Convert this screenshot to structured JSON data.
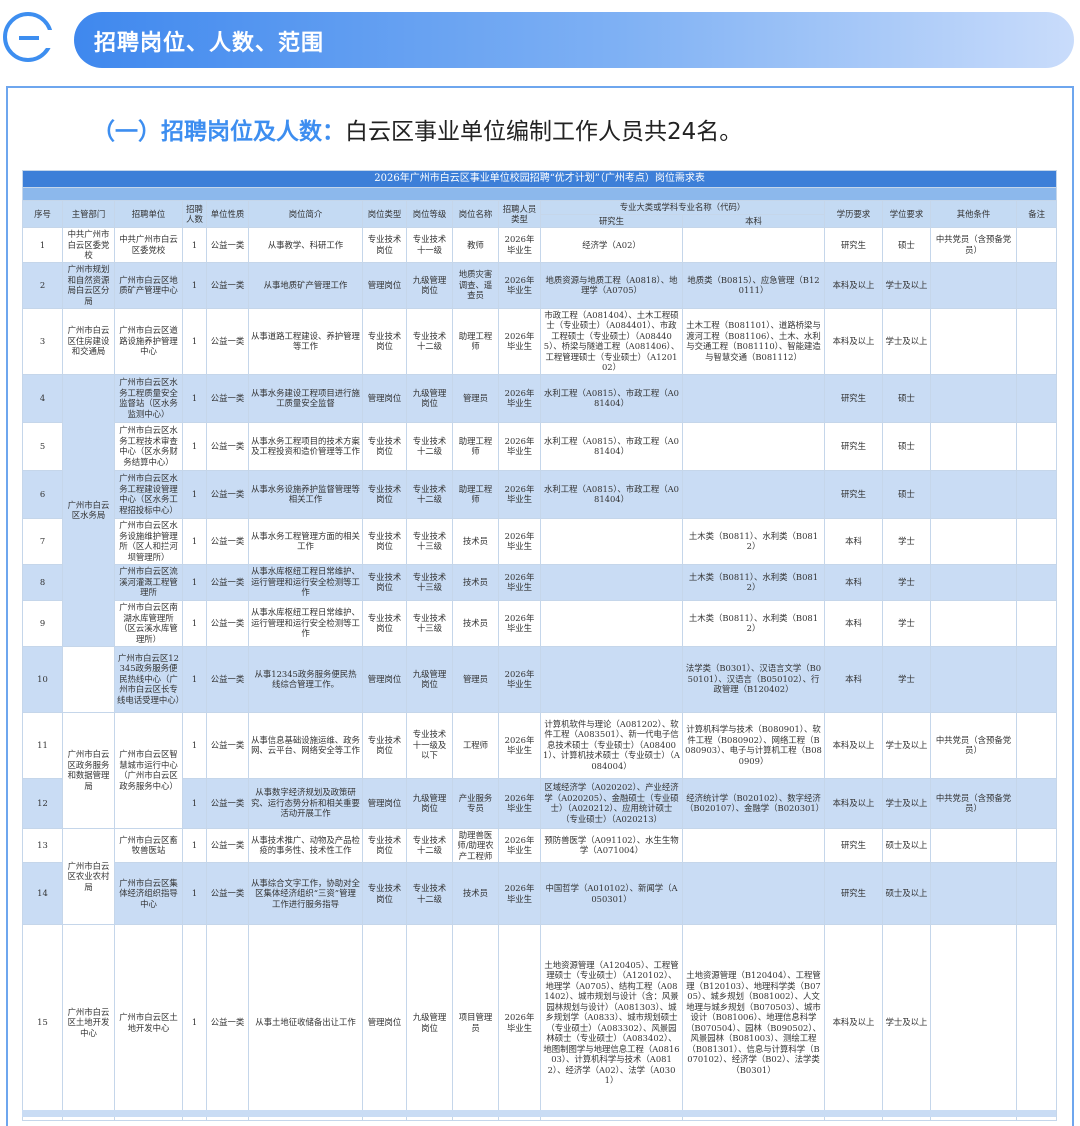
{
  "header": {
    "title": "招聘岗位、人数、范围"
  },
  "section": {
    "highlight": "（一）招聘岗位及人数：",
    "text": "白云区事业单位编制工作人员共24名。"
  },
  "table": {
    "title": "2026年广州市白云区事业单位校园招聘“优才计划”（广州考点）岗位需求表",
    "headers": {
      "seq": "序号",
      "dept": "主管部门",
      "unit": "招聘单位",
      "count": "招聘人数",
      "nature": "单位性质",
      "intro": "岗位简介",
      "type": "岗位类型",
      "level": "岗位等级",
      "name": "岗位名称",
      "target": "招聘人员类型",
      "major": "专业大类或学科专业名称（代码）",
      "grad": "研究生",
      "under": "本科",
      "edu": "学历要求",
      "degree": "学位要求",
      "other": "其他条件",
      "note": "备注"
    },
    "rows": [
      {
        "seq": "1",
        "dept": "中共广州市白云区委党校",
        "unit": "中共广州市白云区委党校",
        "count": "1",
        "nature": "公益一类",
        "intro": "从事教学、科研工作",
        "type": "专业技术岗位",
        "level": "专业技术十一级",
        "name": "教师",
        "target": "2026年毕业生",
        "grad": "经济学（A02）",
        "under": "",
        "edu": "研究生",
        "degree": "硕士",
        "other": "中共党员（含预备党员）"
      },
      {
        "seq": "2",
        "dept": "广州市规划和自然资源局白云区分局",
        "unit": "广州市白云区地质矿产管理中心",
        "count": "1",
        "nature": "公益一类",
        "intro": "从事地质矿产管理工作",
        "type": "管理岗位",
        "level": "九级管理岗位",
        "name": "地质灾害调查、遥查员",
        "target": "2026年毕业生",
        "grad": "地质资源与地质工程（A0818）、地理学（A0705）",
        "under": "地质类（B0815）、应急管理（B120111）",
        "edu": "本科及以上",
        "degree": "学士及以上",
        "other": ""
      },
      {
        "seq": "3",
        "dept": "广州市白云区住房建设和交通局",
        "unit": "广州市白云区道路设施养护管理中心",
        "count": "1",
        "nature": "公益一类",
        "intro": "从事道路工程建设、养护管理等工作",
        "type": "专业技术岗位",
        "level": "专业技术十二级",
        "name": "助理工程师",
        "target": "2026年毕业生",
        "grad": "市政工程（A081404）、土木工程硕士（专业硕士）（A084401）、市政工程硕士（专业硕士）（A084405）、桥梁与隧道工程（A081406）、工程管理硕士（专业硕士）（A120102）",
        "under": "土木工程（B081101）、道路桥梁与渡河工程（B081106）、土木、水利与交通工程（B081110）、智能建造与智慧交通（B081112）",
        "edu": "本科及以上",
        "degree": "学士及以上",
        "other": ""
      },
      {
        "seq": "4",
        "dept": "",
        "unit": "广州市白云区水务工程质量安全监督站（区水务监测中心）",
        "count": "1",
        "nature": "公益一类",
        "intro": "从事水务建设工程项目进行施工质量安全监督",
        "type": "管理岗位",
        "level": "九级管理岗位",
        "name": "管理员",
        "target": "2026年毕业生",
        "grad": "水利工程（A0815）、市政工程（A081404）",
        "under": "",
        "edu": "研究生",
        "degree": "硕士",
        "other": ""
      },
      {
        "seq": "5",
        "dept": "",
        "unit": "广州市白云区水务工程技术审查中心（区水务财务结算中心）",
        "count": "1",
        "nature": "公益一类",
        "intro": "从事水务工程项目的技术方案及工程投资和造价管理等工作",
        "type": "专业技术岗位",
        "level": "专业技术十二级",
        "name": "助理工程师",
        "target": "2026年毕业生",
        "grad": "水利工程（A0815）、市政工程（A081404）",
        "under": "",
        "edu": "研究生",
        "degree": "硕士",
        "other": ""
      },
      {
        "seq": "6",
        "dept": "广州市白云区水务局",
        "unit": "广州市白云区水务工程建设管理中心（区水务工程招投标中心）",
        "count": "1",
        "nature": "公益一类",
        "intro": "从事水务设施养护监督管理等相关工作",
        "type": "专业技术岗位",
        "level": "专业技术十二级",
        "name": "助理工程师",
        "target": "2026年毕业生",
        "grad": "水利工程（A0815）、市政工程（A081404）",
        "under": "",
        "edu": "研究生",
        "degree": "硕士",
        "other": ""
      },
      {
        "seq": "7",
        "dept": "",
        "unit": "广州市白云区水务设施维护管理所（区人和拦河坝管理所）",
        "count": "1",
        "nature": "公益一类",
        "intro": "从事水务工程管理方面的相关工作",
        "type": "专业技术岗位",
        "level": "专业技术十三级",
        "name": "技术员",
        "target": "2026年毕业生",
        "grad": "",
        "under": "土木类（B0811）、水利类（B0812）",
        "edu": "本科",
        "degree": "学士",
        "other": ""
      },
      {
        "seq": "8",
        "dept": "",
        "unit": "广州市白云区流溪河灌溉工程管理所",
        "count": "1",
        "nature": "公益一类",
        "intro": "从事水库枢纽工程日常维护、运行管理和运行安全检测等工作",
        "type": "专业技术岗位",
        "level": "专业技术十三级",
        "name": "技术员",
        "target": "2026年毕业生",
        "grad": "",
        "under": "土木类（B0811）、水利类（B0812）",
        "edu": "本科",
        "degree": "学士",
        "other": ""
      },
      {
        "seq": "9",
        "dept": "",
        "unit": "广州市白云区南湖水库管理所（区云溪水库管理所）",
        "count": "1",
        "nature": "公益一类",
        "intro": "从事水库枢纽工程日常维护、运行管理和运行安全检测等工作",
        "type": "专业技术岗位",
        "level": "专业技术十三级",
        "name": "技术员",
        "target": "2026年毕业生",
        "grad": "",
        "under": "土木类（B0811）、水利类（B0812）",
        "edu": "本科",
        "degree": "学士",
        "other": ""
      },
      {
        "seq": "10",
        "dept": "",
        "unit": "广州市白云区12345政务服务便民热线中心（广州市白云区长专线电话受理中心）",
        "count": "1",
        "nature": "公益一类",
        "intro": "从事12345政务服务便民热线综合管理工作。",
        "type": "管理岗位",
        "level": "九级管理岗位",
        "name": "管理员",
        "target": "2026年毕业生",
        "grad": "",
        "under": "法学类（B0301）、汉语言文学（B050101）、汉语言（B050102）、行政管理（B120402）",
        "edu": "本科",
        "degree": "学士",
        "other": ""
      },
      {
        "seq": "11",
        "dept": "广州市白云区政务服务和数据管理局",
        "unit": "广州市白云区智慧城市运行中心（广州市白云区政务服务中心）",
        "count": "1",
        "nature": "公益一类",
        "intro": "从事信息基础设施运维、政务网、云平台、网络安全等工作",
        "type": "专业技术岗位",
        "level": "专业技术十一级及以下",
        "name": "工程师",
        "target": "2026年毕业生",
        "grad": "计算机软件与理论（A081202）、软件工程（A083501）、新一代电子信息技术硕士（专业硕士）（A084001）、计算机技术硕士（专业硕士）（A084004）",
        "under": "计算机科学与技术（B080901）、软件工程（B080902）、网络工程（B080903）、电子与计算机工程（B080909）",
        "edu": "本科及以上",
        "degree": "学士及以上",
        "other": "中共党员（含预备党员）"
      },
      {
        "seq": "12",
        "dept": "",
        "unit": "",
        "count": "1",
        "nature": "公益一类",
        "intro": "从事数字经济规划及政策研究、运行态势分析和相关重要活动开展工作",
        "type": "管理岗位",
        "level": "九级管理岗位",
        "name": "产业服务专员",
        "target": "2026年毕业生",
        "grad": "区域经济学（A020202）、产业经济学（A020205）、金融硕士（专业硕士）（A020212）、应用统计硕士（专业硕士）（A020213）",
        "under": "经济统计学（B020102）、数字经济（B020107）、金融学（B020301）",
        "edu": "本科及以上",
        "degree": "学士及以上",
        "other": "中共党员（含预备党员）"
      },
      {
        "seq": "13",
        "dept": "",
        "unit": "广州市白云区畜牧兽医站",
        "count": "1",
        "nature": "公益一类",
        "intro": "从事技术推广、动物及产品检疫的事务性、技术性工作",
        "type": "专业技术岗位",
        "level": "专业技术十二级",
        "name": "助理兽医师/助理农产工程师",
        "target": "2026年毕业生",
        "grad": "预防兽医学（A091102）、水生生物学（A071004）",
        "under": "",
        "edu": "研究生",
        "degree": "硕士及以上",
        "other": ""
      },
      {
        "seq": "14",
        "dept": "广州市白云区农业农村局",
        "unit": "广州市白云区集体经济组织指导中心",
        "count": "1",
        "nature": "公益一类",
        "intro": "从事综合文字工作，协助对全区集体经济组织“三资”管理工作进行服务指导",
        "type": "专业技术岗位",
        "level": "专业技术十二级",
        "name": "技术员",
        "target": "2026年毕业生",
        "grad": "中国哲学（A010102）、新闻学（A050301）",
        "under": "",
        "edu": "研究生",
        "degree": "硕士及以上",
        "other": ""
      },
      {
        "seq": "15",
        "dept": "广州市白云区土地开发中心",
        "unit": "广州市白云区土地开发中心",
        "count": "1",
        "nature": "公益一类",
        "intro": "从事土地征收储备出让工作",
        "type": "管理岗位",
        "level": "九级管理岗位",
        "name": "项目管理员",
        "target": "2026年毕业生",
        "grad": "土地资源管理（A120405）、工程管理硕士（专业硕士）（A120102）、地理学（A0705）、结构工程（A081402）、城市规划与设计（含：风景园林规划与设计）（A081303）、城乡规划学（A0833）、城市规划硕士（专业硕士）（A083302）、风景园林硕士（专业硕士）（A083402）、地图制图学与地理信息工程（A081603）、计算机科学与技术（A0812）、经济学（A02）、法学（A0301）",
        "under": "土地资源管理（B120404）、工程管理（B120103）、地理科学类（B0705）、城乡规划（B081002）、人文地理与城乡规划（B070503）、城市设计（B081006）、地理信息科学（B070504）、园林（B090502）、风景园林（B081003）、测绘工程（B081301）、信息与计算科学（B070102）、经济学（B02）、法学类（B0301）",
        "edu": "本科及以上",
        "degree": "学士及以上",
        "other": ""
      }
    ]
  },
  "colors": {
    "accent": "#3d8ef0",
    "table_title_bg": "#3d7fd8",
    "row_alt": "#c9dcf4"
  }
}
